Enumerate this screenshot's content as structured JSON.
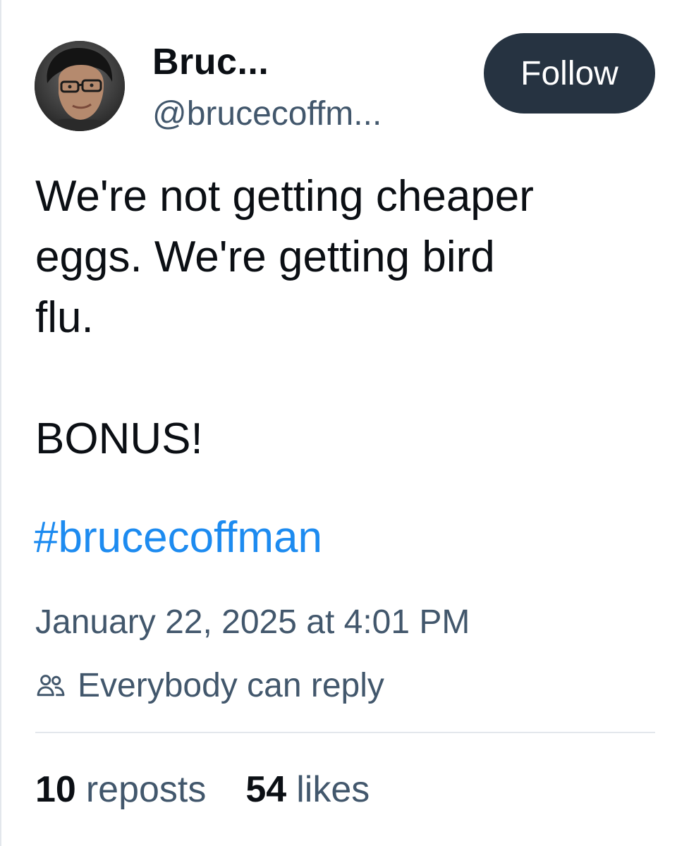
{
  "author": {
    "display_name": "Bruc...",
    "handle": "@brucecoffm..."
  },
  "follow_button": {
    "label": "Follow"
  },
  "post": {
    "text_lines": [
      "We're not getting cheaper",
      "eggs. We're getting bird",
      "flu.",
      "",
      "BONUS!"
    ],
    "hashtag": "#brucecoffman",
    "timestamp": "January 22, 2025 at 4:01 PM",
    "reply_setting": "Everybody can reply",
    "reply_icon": "people-icon"
  },
  "stats": {
    "reposts_count": "10",
    "reposts_label": "reposts",
    "likes_count": "54",
    "likes_label": "likes"
  },
  "colors": {
    "text_primary": "#0b0f14",
    "text_secondary": "#42576c",
    "link": "#1d8bf0",
    "button_bg": "#263341",
    "button_text": "#ffffff",
    "divider": "#e3e7ec"
  }
}
